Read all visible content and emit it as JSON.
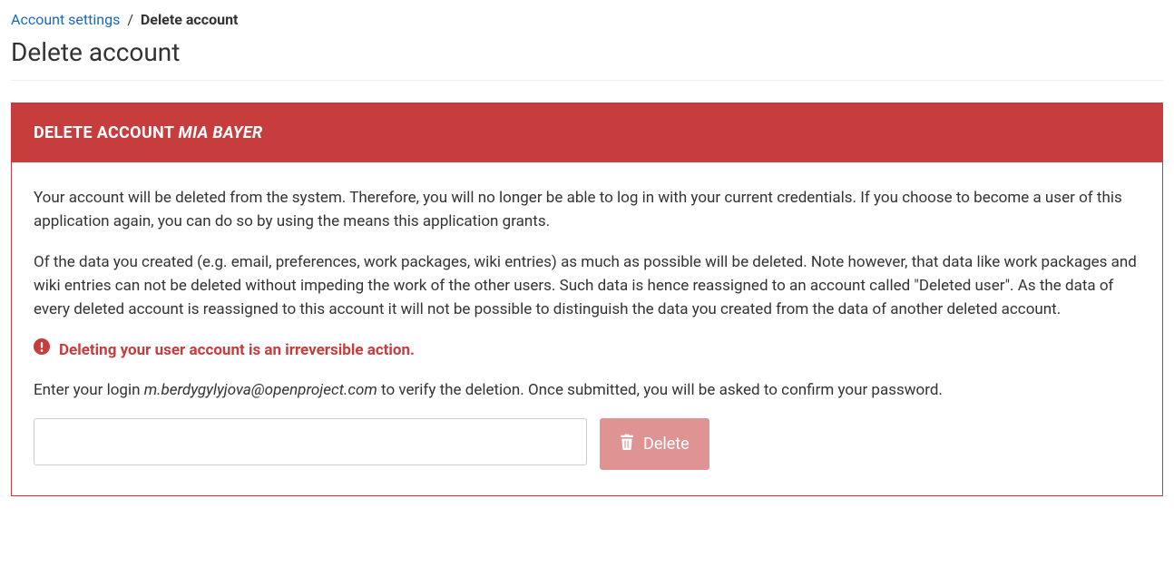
{
  "breadcrumb": {
    "parent": "Account settings",
    "separator": "/",
    "current": "Delete account"
  },
  "page_title": "Delete account",
  "panel": {
    "header_prefix": "Delete account",
    "username": "Mia Bayer",
    "paragraph1": "Your account will be deleted from the system. Therefore, you will no longer be able to log in with your current credentials. If you choose to become a user of this application again, you can do so by using the means this application grants.",
    "paragraph2": "Of the data you created (e.g. email, preferences, work packages, wiki entries) as much as possible will be deleted. Note however, that data like work packages and wiki entries can not be deleted without impeding the work of the other users. Such data is hence reassigned to an account called \"Deleted user\". As the data of every deleted account is reassigned to this account it will not be possible to distinguish the data you created from the data of another deleted account.",
    "warning": "Deleting your user account is an irreversible action.",
    "verify_prefix": "Enter your login ",
    "login_email": "m.berdygylyjova@openproject.com",
    "verify_suffix": " to verify the deletion. Once submitted, you will be asked to confirm your password.",
    "delete_button_label": "Delete"
  }
}
